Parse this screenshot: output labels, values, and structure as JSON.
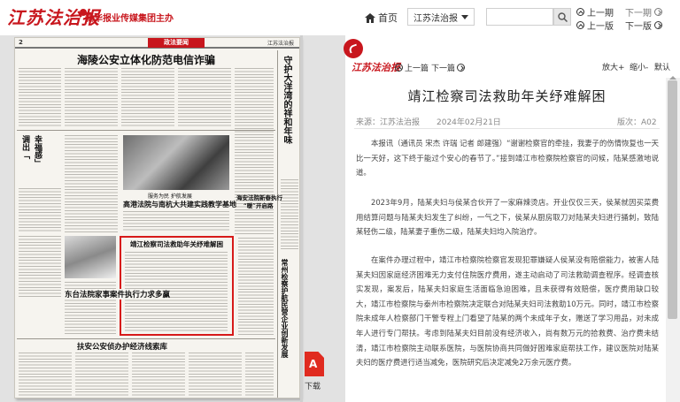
{
  "header": {
    "logo": "江苏法治报",
    "sublogo": "新华报业传媒集团主办",
    "home_label": "首页",
    "edition_select": "江苏法治报",
    "search_placeholder": "",
    "prev_issue": "上一期",
    "next_issue": "下一期",
    "prev_page": "上一版",
    "next_page": "下一版"
  },
  "newspaper": {
    "page_num": "2",
    "section": "政法要闻",
    "masthead_small": "江苏法治报",
    "headlines": {
      "top": "海陵公安立体化防范电信诈骗",
      "right_vertical": "守护大洋湾的祥和年味",
      "left_vertical_1": "调出「",
      "left_vertical_2": "幸福感」",
      "mid_caption": "服务为民   护航发展",
      "court": "高港法院与南杭大共建实践教学基地",
      "right_box": "海安法院新春执行",
      "right_box2": "“暖”开启路",
      "boxed": "靖江检察司法救助年关纾难解困",
      "bottom_left": "东台法院家事案件执行力求多赢",
      "bottom": "扶安公安侦办护经济线索库",
      "right_vertical_2": "常州检察护航民营企业创新发展"
    },
    "download_label": "下载",
    "pdf_glyph": "A"
  },
  "article": {
    "mini_logo": "江苏法治报",
    "prev_article": "上一篇",
    "next_article": "下一篇",
    "zoom_in": "放大+",
    "zoom_out": "缩小-",
    "default_size": "默认",
    "title": "靖江检察司法救助年关纾难解困",
    "source": "来源：江苏法治报",
    "date": "2024年02月21日",
    "edition": "版次：A02",
    "paragraphs": [
      "本报讯（通讯员 宋杰 许瑞 记者 郎建强）“谢谢检察官的牵挂，我妻子的伤情恢复也一天比一天好，这下终于能过个安心的春节了。”接到靖江市检察院检察官的问候，陆某感激地说道。",
      "2023年9月，陆某夫妇与侯某合伙开了一家麻辣烫店。开业仅仅三天，侯某就因买菜费用结算问题与陆某夫妇发生了纠纷，一气之下，侯某从厨房取刀对陆某夫妇进行捅刺，致陆某轻伤二级，陆某妻子重伤二级，陆某夫妇均入院治疗。",
      "在案件办理过程中，靖江市检察院检察官发现犯罪嫌疑人侯某没有赔偿能力，被害人陆某夫妇因家庭经济困难无力支付住院医疗费用，遂主动启动了司法救助调查程序。经调查核实发现，案发后，陆某夫妇家庭生活面临急迫困难，且未获得有效赔偿，医疗费用缺口较大，靖江市检察院与泰州市检察院决定联合对陆某夫妇司法救助10万元。同时，靖江市检察院未成年人检察部门干警专程上门看望了陆某的两个未成年子女，赠送了学习用品，对未成年人进行专门帮扶。考虑到陆某夫妇目前没有经济收入，尚有数万元的拾救费、治疗费未结清，靖江市检察院主动联系医院，与医院协商共同做好困难家庭帮扶工作，建议医院对陆某夫妇的医疗费进行适当减免，医院研究后决定减免2万余元医疗费。"
    ]
  },
  "colors": {
    "brand_red": "#c8161d",
    "box_red": "#d71a1a",
    "pdf_red": "#e02b20"
  },
  "icons": {
    "home": "home-icon",
    "search": "search-icon",
    "back": "back-arrow-icon",
    "pdf": "pdf-icon",
    "prev": "chevron-left-circle-icon",
    "next": "chevron-right-circle-icon"
  }
}
